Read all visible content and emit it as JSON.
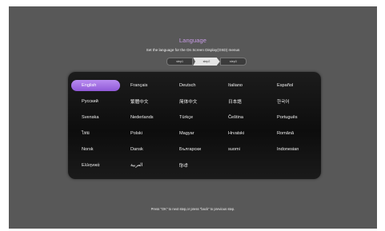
{
  "screen": {
    "title": "Language",
    "subtitle": "Set the language for the On Screen Display(OSD) menus",
    "steps": [
      "step1",
      "step2",
      "step3"
    ],
    "active_step": 2,
    "footer": "Press \"OK\" to next step,or press \"back\" to previous step."
  },
  "colors": {
    "title": "#c89be6",
    "selected": "#a070e0",
    "background": "#585858"
  },
  "languages": [
    "English",
    "Français",
    "Deutsch",
    "Italiano",
    "Español",
    "Русский",
    "繁體中文",
    "简体中文",
    "日本語",
    "한국어",
    "Svenska",
    "Nederlands",
    "Türkçe",
    "Čeština",
    "Português",
    "ไทย",
    "Polski",
    "Magyar",
    "Hrvatski",
    "Română",
    "Norsk",
    "Dansk",
    "Български",
    "suomi",
    "Indonesian",
    "Ελληνικά",
    "العربية",
    "हिन्दी"
  ],
  "selected_language": "English"
}
